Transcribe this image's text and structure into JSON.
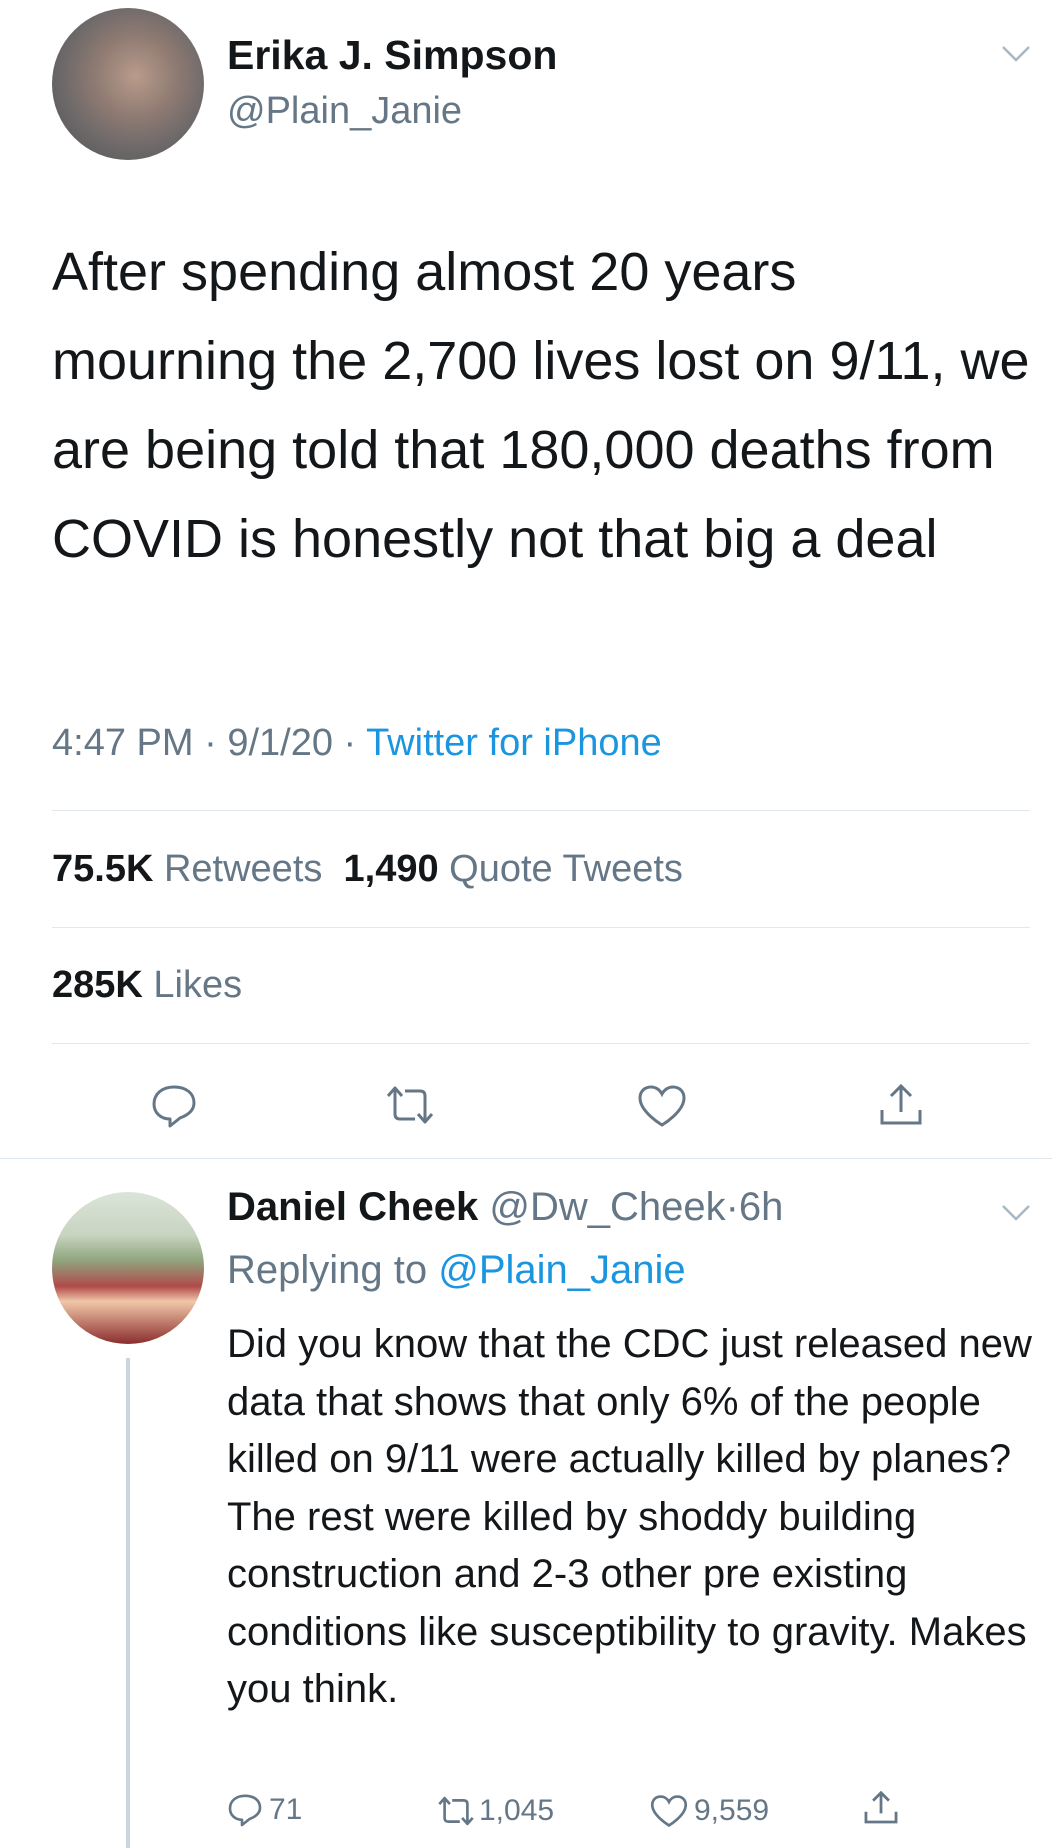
{
  "main_tweet": {
    "author_name": "Erika J. Simpson",
    "author_handle": "@Plain_Janie",
    "text": "After spending almost 20 years mourning the 2,700 lives lost on 9/11, we are being told that 180,000 deaths from COVID is honestly not that big a deal",
    "time": "4:47 PM",
    "date": "9/1/20",
    "separator": "·",
    "source": "Twitter for iPhone",
    "retweets_count": "75.5K",
    "retweets_label": "Retweets",
    "quotes_count": "1,490",
    "quotes_label": "Quote Tweets",
    "likes_count": "285K",
    "likes_label": "Likes"
  },
  "reply": {
    "author_name": "Daniel Cheek",
    "author_handle": "@Dw_Cheek",
    "separator": "·",
    "age": "6h",
    "replying_label": "Replying to",
    "replying_handle": "@Plain_Janie",
    "text": "Did you know that the CDC just released new data that shows that only 6% of the people killed on 9/11 were actually killed by planes? The rest were killed by shoddy building construction and 2-3 other pre existing conditions like susceptibility to gravity. Makes you think.",
    "reply_count": "71",
    "retweet_count": "1,045",
    "like_count": "9,559"
  },
  "icons": [
    "chevron-down-icon",
    "reply-icon",
    "retweet-icon",
    "like-icon",
    "share-icon"
  ],
  "colors": {
    "link": "#1b95e0",
    "secondary": "#657786",
    "divider": "#e1e8ed"
  }
}
